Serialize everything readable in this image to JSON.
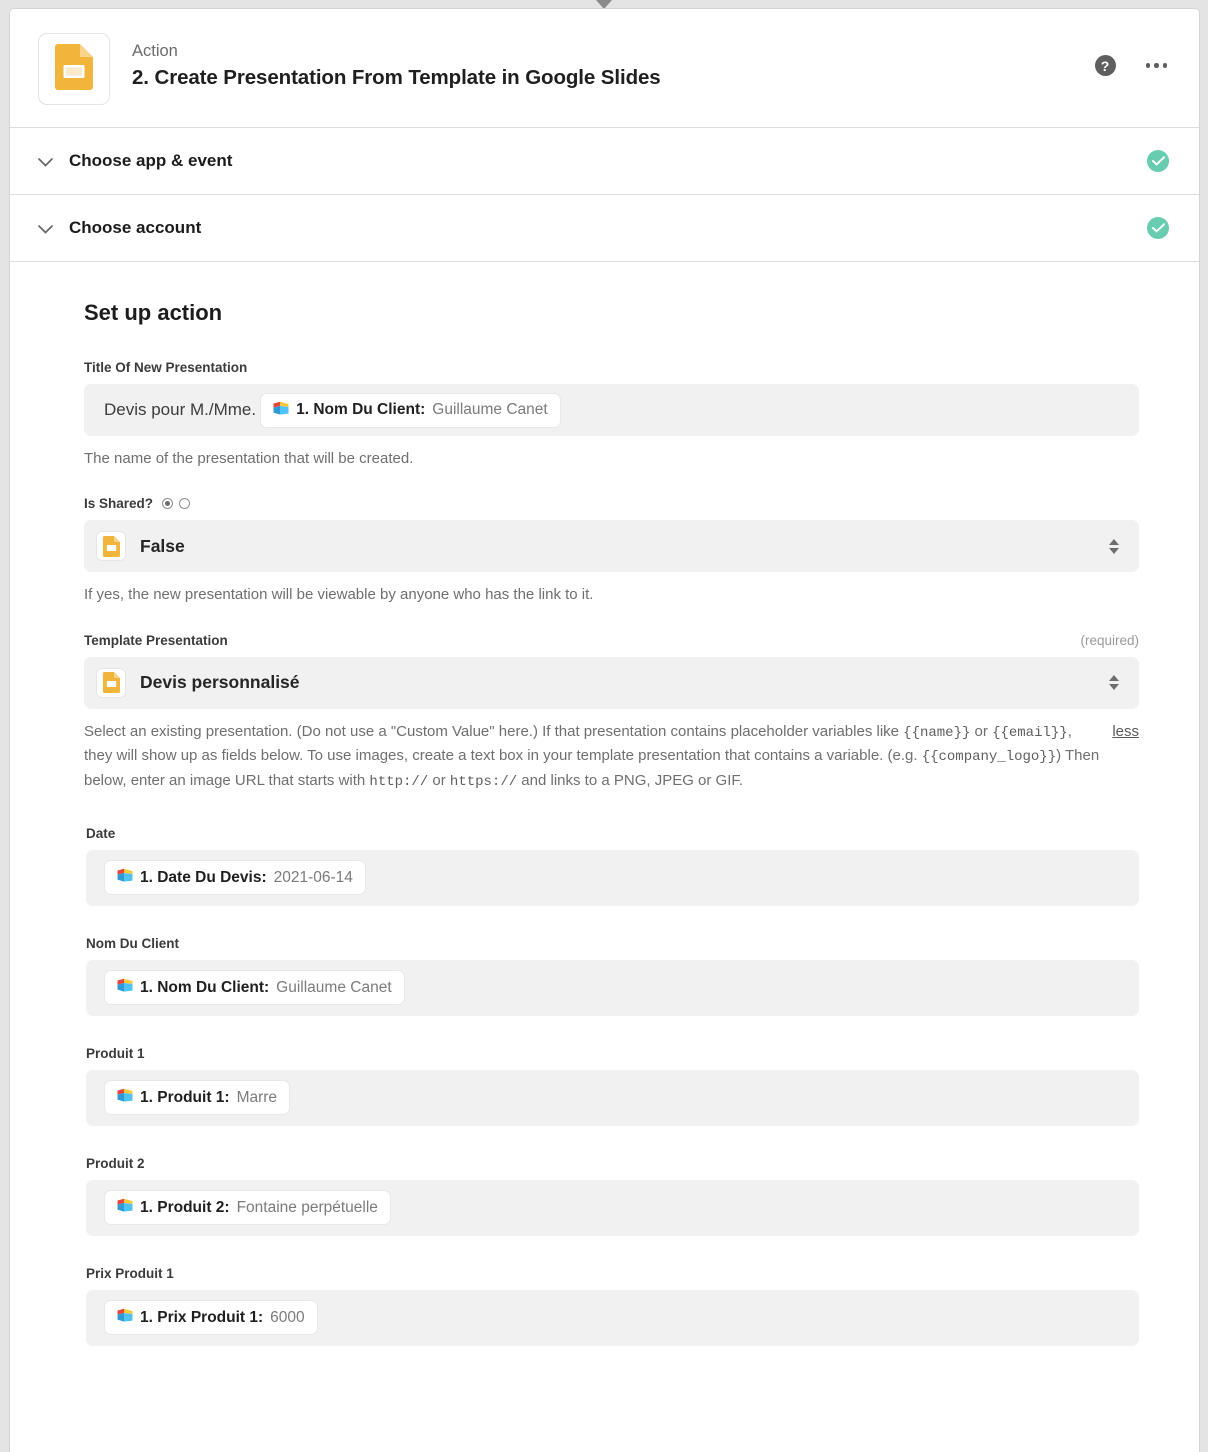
{
  "header": {
    "kicker": "Action",
    "title": "2. Create Presentation From Template in Google Slides",
    "app_icon": "google-slides-icon",
    "help_icon": "help-circle-icon",
    "help_glyph": "?",
    "more_icon": "ellipsis-icon"
  },
  "collapsed_sections": [
    {
      "label": "Choose app & event",
      "status": "complete",
      "chevron": "chevron-down-icon"
    },
    {
      "label": "Choose account",
      "status": "complete",
      "chevron": "chevron-down-icon"
    }
  ],
  "main": {
    "section_title": "Set up action",
    "title_field": {
      "label": "Title Of New Presentation",
      "static_text": "Devis pour M./Mme.",
      "pill": {
        "key": "1. Nom Du Client:",
        "value": "Guillaume Canet",
        "icon": "zap-step-icon"
      },
      "help": "The name of the presentation that will be created."
    },
    "is_shared": {
      "label": "Is Shared?",
      "radio_selected_index": 0,
      "radio_count": 2,
      "value": "False",
      "icon": "google-slides-icon",
      "help": "If yes, the new presentation will be viewable by anyone who has the link to it."
    },
    "template": {
      "label": "Template Presentation",
      "required_text": "(required)",
      "value": "Devis personnalisé",
      "icon": "google-slides-icon",
      "less_link": "less",
      "help_parts": {
        "p1": "Select an existing presentation. (Do not use a \"Custom Value\" here.) If that presentation contains placeholder variables like ",
        "c1": "{{name}}",
        "p2": " or ",
        "c2": "{{email}}",
        "p3": ", they will show up as fields below. To use images, create a text box in your template presentation that contains a variable. (e.g. ",
        "c3": "{{company_logo}}",
        "p4": ") Then below, enter an image URL that starts with ",
        "c4": "http://",
        "p5": " or ",
        "c5": "https://",
        "p6": " and links to a PNG, JPEG or GIF."
      }
    },
    "template_variable_fields": [
      {
        "label": "Date",
        "pill": {
          "key": "1. Date Du Devis:",
          "value": "2021-06-14",
          "icon": "zap-step-icon"
        }
      },
      {
        "label": "Nom Du Client",
        "pill": {
          "key": "1. Nom Du Client:",
          "value": "Guillaume Canet",
          "icon": "zap-step-icon"
        }
      },
      {
        "label": "Produit 1",
        "pill": {
          "key": "1. Produit 1:",
          "value": "Marre",
          "icon": "zap-step-icon"
        }
      },
      {
        "label": "Produit 2",
        "pill": {
          "key": "1. Produit 2:",
          "value": "Fontaine perpétuelle",
          "icon": "zap-step-icon"
        }
      },
      {
        "label": "Prix Produit 1",
        "pill": {
          "key": "1. Prix Produit 1:",
          "value": "6000",
          "icon": "zap-step-icon"
        }
      }
    ]
  },
  "colors": {
    "slides_yellow": "#F2B53C",
    "check_green": "#68CCB0",
    "field_bg": "#F1F1F1",
    "page_bg": "#E4E4E4"
  }
}
